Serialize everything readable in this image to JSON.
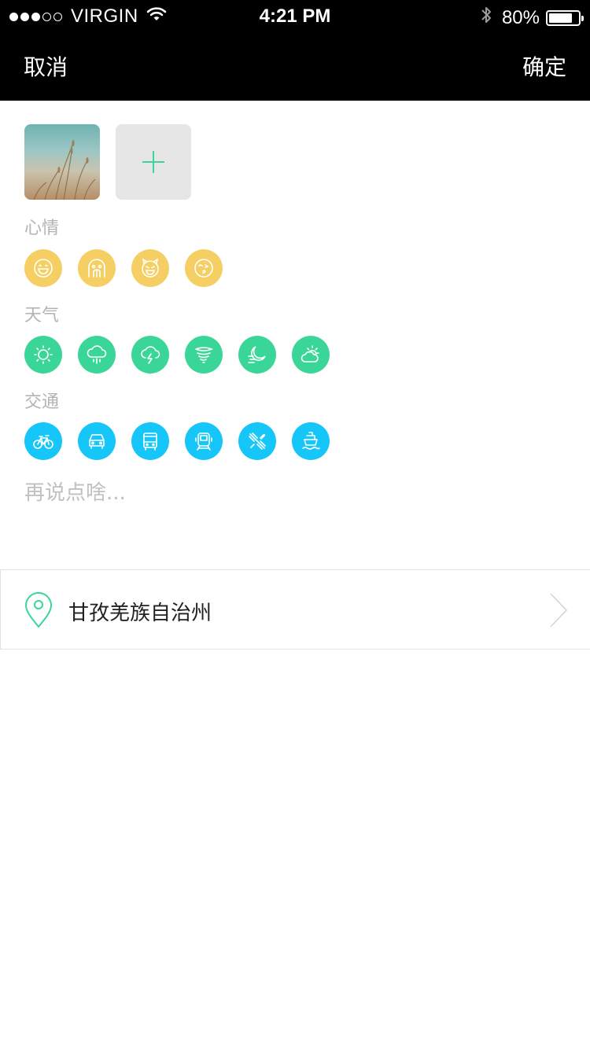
{
  "status_bar": {
    "carrier": "VIRGIN",
    "signal_dots": [
      true,
      true,
      true,
      false,
      false
    ],
    "time": "4:21 PM",
    "battery_percent": "80%",
    "battery_level": 0.8
  },
  "nav": {
    "cancel_label": "取消",
    "confirm_label": "确定"
  },
  "photos": {
    "items": [
      {
        "kind": "photo-thumbnail"
      }
    ],
    "add_icon": "plus-icon"
  },
  "mood": {
    "label": "心情",
    "color": "#f5cf63",
    "icons": [
      "grin-face-icon",
      "scared-face-icon",
      "devil-face-icon",
      "wink-face-icon"
    ]
  },
  "weather": {
    "label": "天气",
    "color": "#3ad697",
    "icons": [
      "sun-icon",
      "rain-cloud-icon",
      "thunder-cloud-icon",
      "tornado-icon",
      "moon-wind-icon",
      "partly-cloudy-icon"
    ]
  },
  "traffic": {
    "label": "交通",
    "color": "#16c6f8",
    "icons": [
      "bicycle-icon",
      "car-icon",
      "bus-icon",
      "train-icon",
      "airplane-icon",
      "ship-icon"
    ]
  },
  "note": {
    "placeholder": "再说点啥...",
    "value": ""
  },
  "location": {
    "name": "甘孜羌族自治州",
    "pin_color": "#3ad697"
  }
}
